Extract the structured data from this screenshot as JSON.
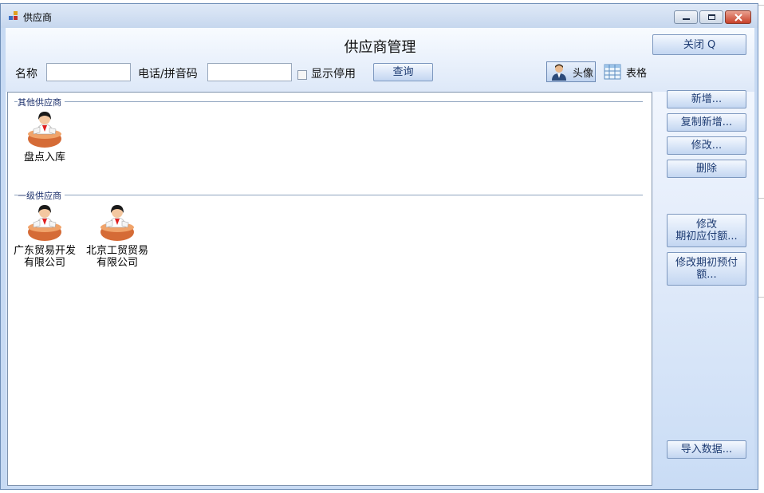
{
  "window": {
    "title": "供应商",
    "minimize_label": "minimize",
    "maximize_label": "maximize",
    "close_label": "close"
  },
  "header": {
    "page_title": "供应商管理",
    "close_button": "关闭 Q"
  },
  "search": {
    "name_label": "名称",
    "name_value": "",
    "phone_label": "电话/拼音码",
    "phone_value": "",
    "show_disabled_label": "显示停用",
    "show_disabled_checked": false,
    "query_button": "查询"
  },
  "view_toggle": {
    "avatar_label": "头像",
    "table_label": "表格",
    "selected": "头像"
  },
  "groups": [
    {
      "name": "其他供应商",
      "items": [
        {
          "lines": [
            "盘点入库"
          ]
        }
      ]
    },
    {
      "name": "一级供应商",
      "items": [
        {
          "lines": [
            "广东贸易开发",
            "有限公司"
          ]
        },
        {
          "lines": [
            "北京工贸贸易",
            "有限公司"
          ]
        }
      ]
    }
  ],
  "side_buttons": {
    "add": "新增...",
    "copy_add": "复制新增...",
    "edit": "修改...",
    "delete": "删除",
    "edit_payable_line1": "修改",
    "edit_payable_line2": "期初应付额...",
    "edit_prepaid_line1": "修改期初预付",
    "edit_prepaid_line2": "额...",
    "import": "导入数据..."
  },
  "colors": {
    "window_frame": "#c7daf3",
    "button_text": "#1d3b72",
    "group_text": "#1b2f6b",
    "close_button": "#c8412a"
  },
  "icons": {
    "supplier": "supplier-avatar-icon",
    "avatar_view": "person-avatar-icon",
    "table_view": "grid-table-icon",
    "app": "app-window-icon"
  }
}
